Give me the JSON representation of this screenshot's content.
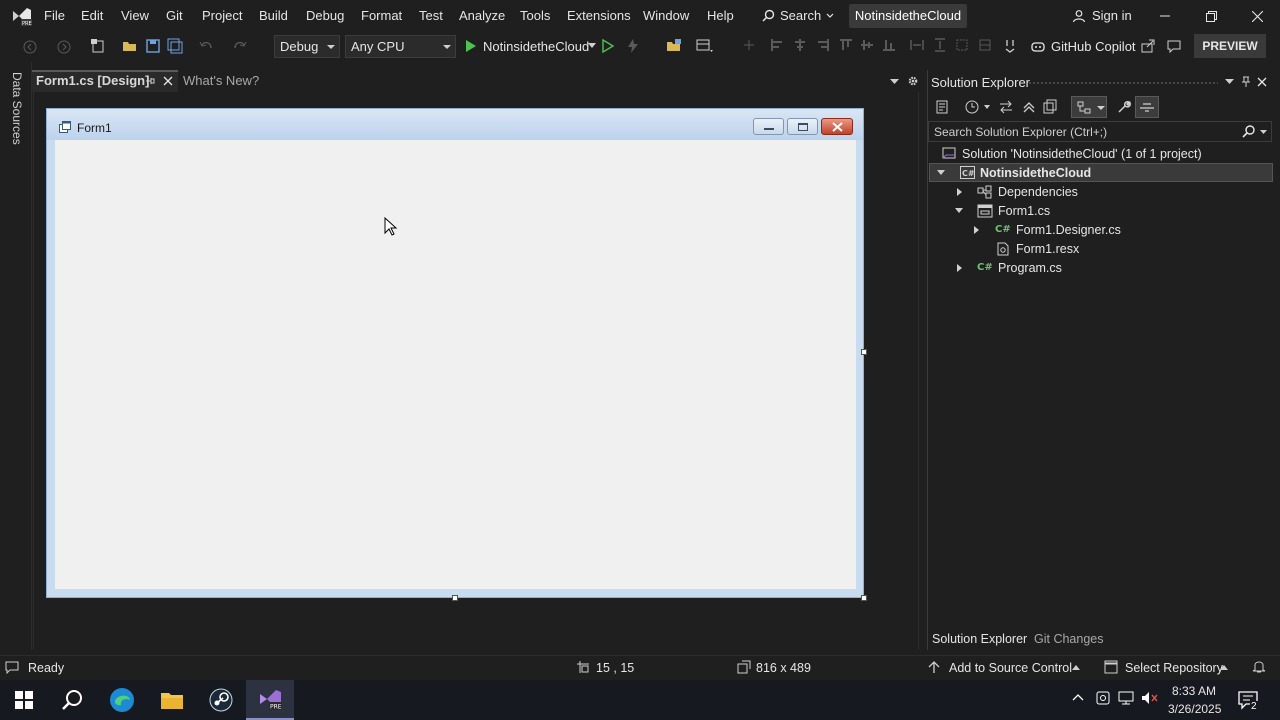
{
  "menu": {
    "items": [
      "File",
      "Edit",
      "View",
      "Git",
      "Project",
      "Build",
      "Debug",
      "Format",
      "Test",
      "Analyze",
      "Tools",
      "Extensions",
      "Window",
      "Help"
    ],
    "search_label": "Search",
    "solution_name": "NotinsidetheCloud",
    "sign_in": "Sign in"
  },
  "toolbar": {
    "configuration": "Debug",
    "platform": "Any CPU",
    "run_target": "NotinsidetheCloud",
    "copilot": "GitHub Copilot",
    "preview": "PREVIEW"
  },
  "left_strip": {
    "data_sources": "Data Sources"
  },
  "tabs": {
    "design": "Form1.cs [Design]",
    "whats_new": "What's New?"
  },
  "form": {
    "title": "Form1"
  },
  "solution_explorer": {
    "title": "Solution Explorer",
    "search_placeholder": "Search Solution Explorer (Ctrl+;)",
    "solution_row": "Solution 'NotinsidetheCloud' (1 of 1 project)",
    "project": "NotinsidetheCloud",
    "dependencies": "Dependencies",
    "form_file": "Form1.cs",
    "designer_file": "Form1.Designer.cs",
    "resx_file": "Form1.resx",
    "program_file": "Program.cs",
    "bottom_tabs": [
      "Solution Explorer",
      "Git Changes"
    ]
  },
  "status": {
    "ready": "Ready",
    "position": "15 , 15",
    "size": "816 x 489",
    "source_control": "Add to Source Control",
    "repository": "Select Repository"
  },
  "taskbar": {
    "time": "8:33 AM",
    "date": "3/26/2025",
    "notification_count": "2"
  },
  "colors": {
    "accent_purple": "#9b6fd6",
    "run_green": "#4ec24e",
    "form_title_blue": "#c9dbee"
  }
}
